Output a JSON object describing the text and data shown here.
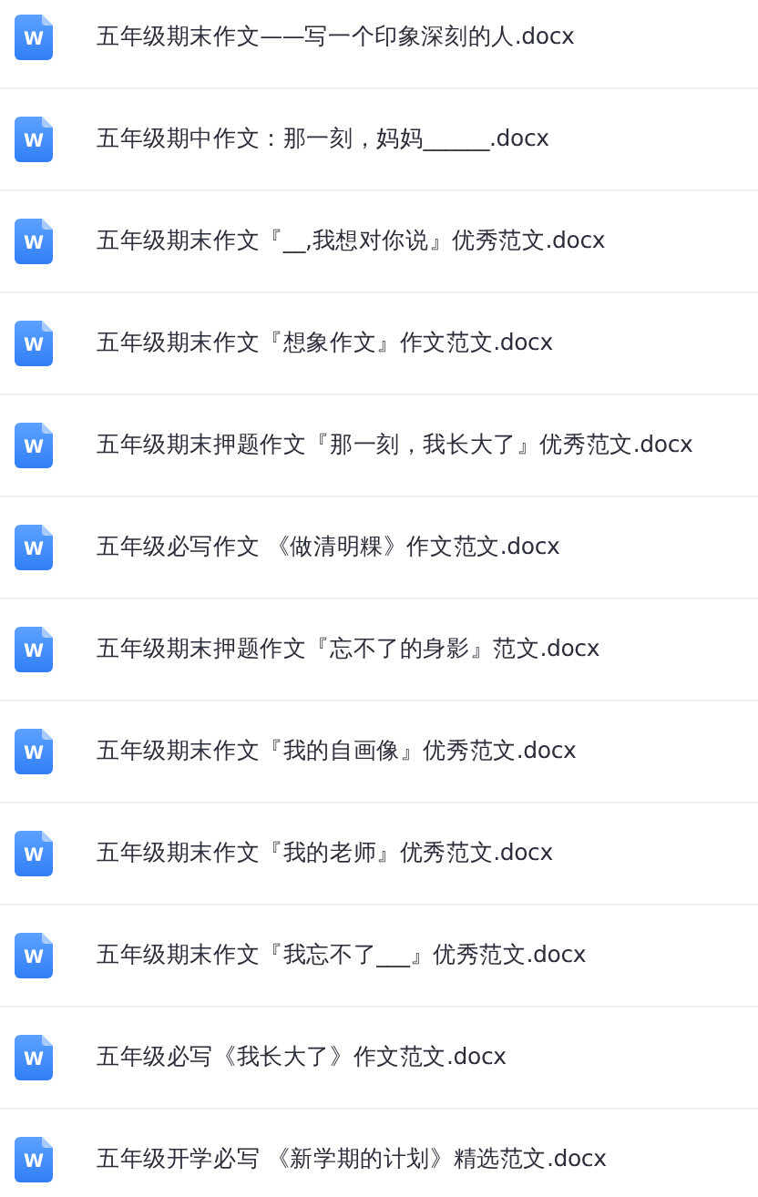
{
  "files": [
    {
      "icon_label": "W",
      "name": "五年级期末作文——写一个印象深刻的人.docx"
    },
    {
      "icon_label": "W",
      "name": "五年级期中作文：那一刻，妈妈______.docx"
    },
    {
      "icon_label": "W",
      "name": "五年级期末作文『__,我想对你说』优秀范文.docx"
    },
    {
      "icon_label": "W",
      "name": "五年级期末作文『想象作文』作文范文.docx"
    },
    {
      "icon_label": "W",
      "name": "五年级期末押题作文『那一刻，我长大了』优秀范文.docx"
    },
    {
      "icon_label": "W",
      "name": "五年级必写作文 《做清明粿》作文范文.docx"
    },
    {
      "icon_label": "W",
      "name": "五年级期末押题作文『忘不了的身影』范文.docx"
    },
    {
      "icon_label": "W",
      "name": "五年级期末作文『我的自画像』优秀范文.docx"
    },
    {
      "icon_label": "W",
      "name": "五年级期末作文『我的老师』优秀范文.docx"
    },
    {
      "icon_label": "W",
      "name": "五年级期末作文『我忘不了___』优秀范文.docx"
    },
    {
      "icon_label": "W",
      "name": "五年级必写《我长大了》作文范文.docx"
    },
    {
      "icon_label": "W",
      "name": "五年级开学必写 《新学期的计划》精选范文.docx"
    }
  ]
}
